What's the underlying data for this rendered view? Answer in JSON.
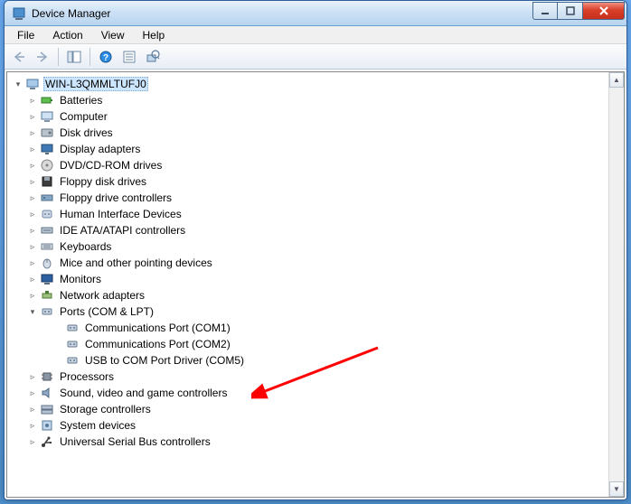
{
  "window": {
    "title": "Device Manager"
  },
  "menu": {
    "file": "File",
    "action": "Action",
    "view": "View",
    "help": "Help"
  },
  "tree": {
    "root": "WIN-L3QMMLTUFJ0",
    "items": [
      {
        "label": "Batteries",
        "icon": "battery"
      },
      {
        "label": "Computer",
        "icon": "computer"
      },
      {
        "label": "Disk drives",
        "icon": "disk"
      },
      {
        "label": "Display adapters",
        "icon": "display"
      },
      {
        "label": "DVD/CD-ROM drives",
        "icon": "dvd"
      },
      {
        "label": "Floppy disk drives",
        "icon": "floppy"
      },
      {
        "label": "Floppy drive controllers",
        "icon": "floppyctrl"
      },
      {
        "label": "Human Interface Devices",
        "icon": "hid"
      },
      {
        "label": "IDE ATA/ATAPI controllers",
        "icon": "ide"
      },
      {
        "label": "Keyboards",
        "icon": "keyboard"
      },
      {
        "label": "Mice and other pointing devices",
        "icon": "mouse"
      },
      {
        "label": "Monitors",
        "icon": "monitor"
      },
      {
        "label": "Network adapters",
        "icon": "network"
      },
      {
        "label": "Ports (COM & LPT)",
        "icon": "port",
        "expanded": true,
        "children": [
          {
            "label": "Communications Port (COM1)",
            "icon": "port"
          },
          {
            "label": "Communications Port (COM2)",
            "icon": "port"
          },
          {
            "label": "USB to COM Port Driver (COM5)",
            "icon": "port"
          }
        ]
      },
      {
        "label": "Processors",
        "icon": "cpu"
      },
      {
        "label": "Sound, video and game controllers",
        "icon": "sound"
      },
      {
        "label": "Storage controllers",
        "icon": "storage"
      },
      {
        "label": "System devices",
        "icon": "system"
      },
      {
        "label": "Universal Serial Bus controllers",
        "icon": "usb"
      }
    ]
  }
}
